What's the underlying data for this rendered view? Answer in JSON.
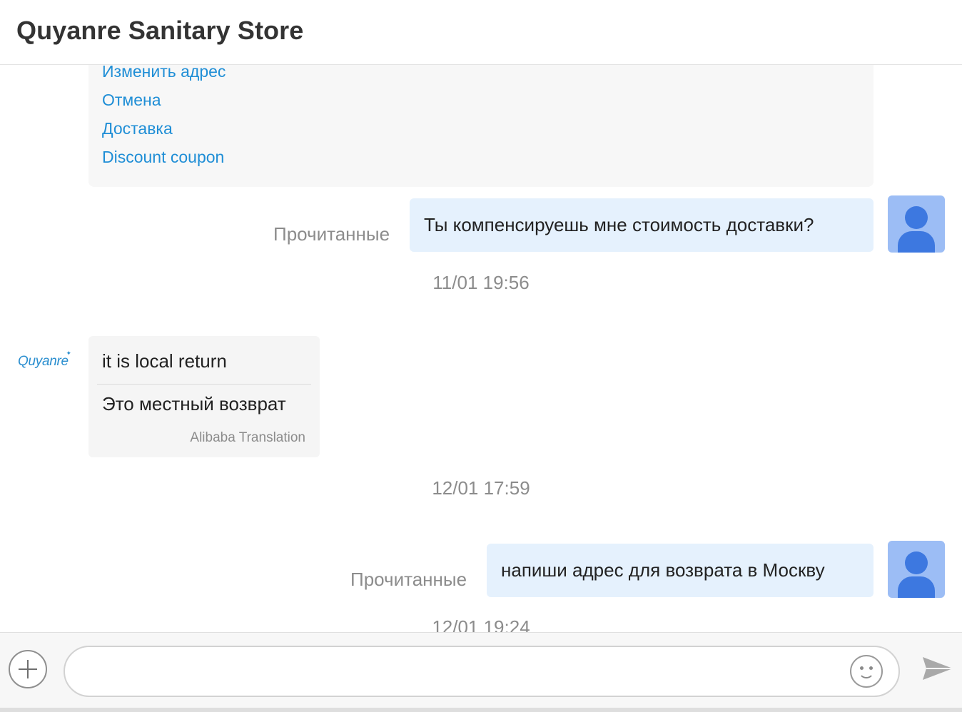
{
  "header": {
    "title": "Quyanre Sanitary Store"
  },
  "menu": {
    "items": [
      {
        "label": "Изменить адрес"
      },
      {
        "label": "Отмена"
      },
      {
        "label": "Доставка"
      },
      {
        "label": "Discount coupon"
      }
    ]
  },
  "messages": {
    "out1": {
      "status": "Прочитанные",
      "text": "Ты компенсируешь мне стоимость доставки?"
    },
    "time1": "11/01 19:56",
    "in1": {
      "sender_logo": "Quyanre",
      "original": "it is local return",
      "translation": "Это местный возврат",
      "translation_source": "Alibaba Translation"
    },
    "time2": "12/01 17:59",
    "out2": {
      "status": "Прочитанные",
      "text": "напиши адрес для возврата в Москву"
    },
    "time3": "12/01 19:24"
  },
  "composer": {
    "input_value": "",
    "input_placeholder": ""
  },
  "icons": {
    "plus": "plus-circle-icon",
    "emoji": "smiley-icon",
    "send": "paper-plane-icon",
    "avatar": "user-avatar-icon"
  },
  "colors": {
    "link": "#1f8ed6",
    "outgoing_bubble": "#e5f1fd",
    "incoming_bubble": "#f5f5f5",
    "avatar_bg": "#9cbdf5",
    "avatar_fg": "#3d78e0"
  }
}
